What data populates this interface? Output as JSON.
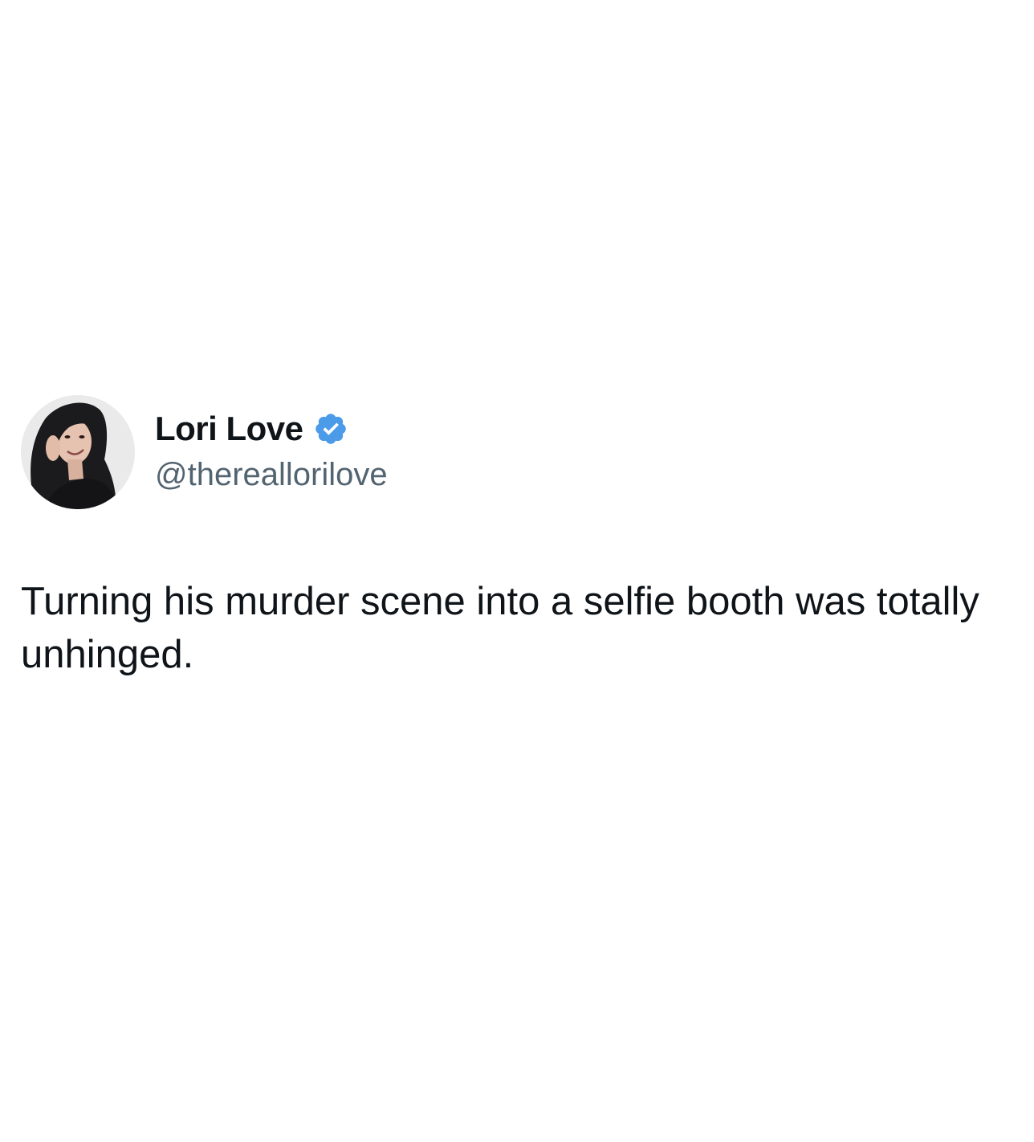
{
  "tweet": {
    "author": {
      "display_name": "Lori Love",
      "handle": "@thereallorilove",
      "verified": true,
      "verified_icon": "verified-badge-icon",
      "verified_color": "#4c9be8"
    },
    "text": "Turning his murder scene into a selfie booth was totally unhinged."
  }
}
